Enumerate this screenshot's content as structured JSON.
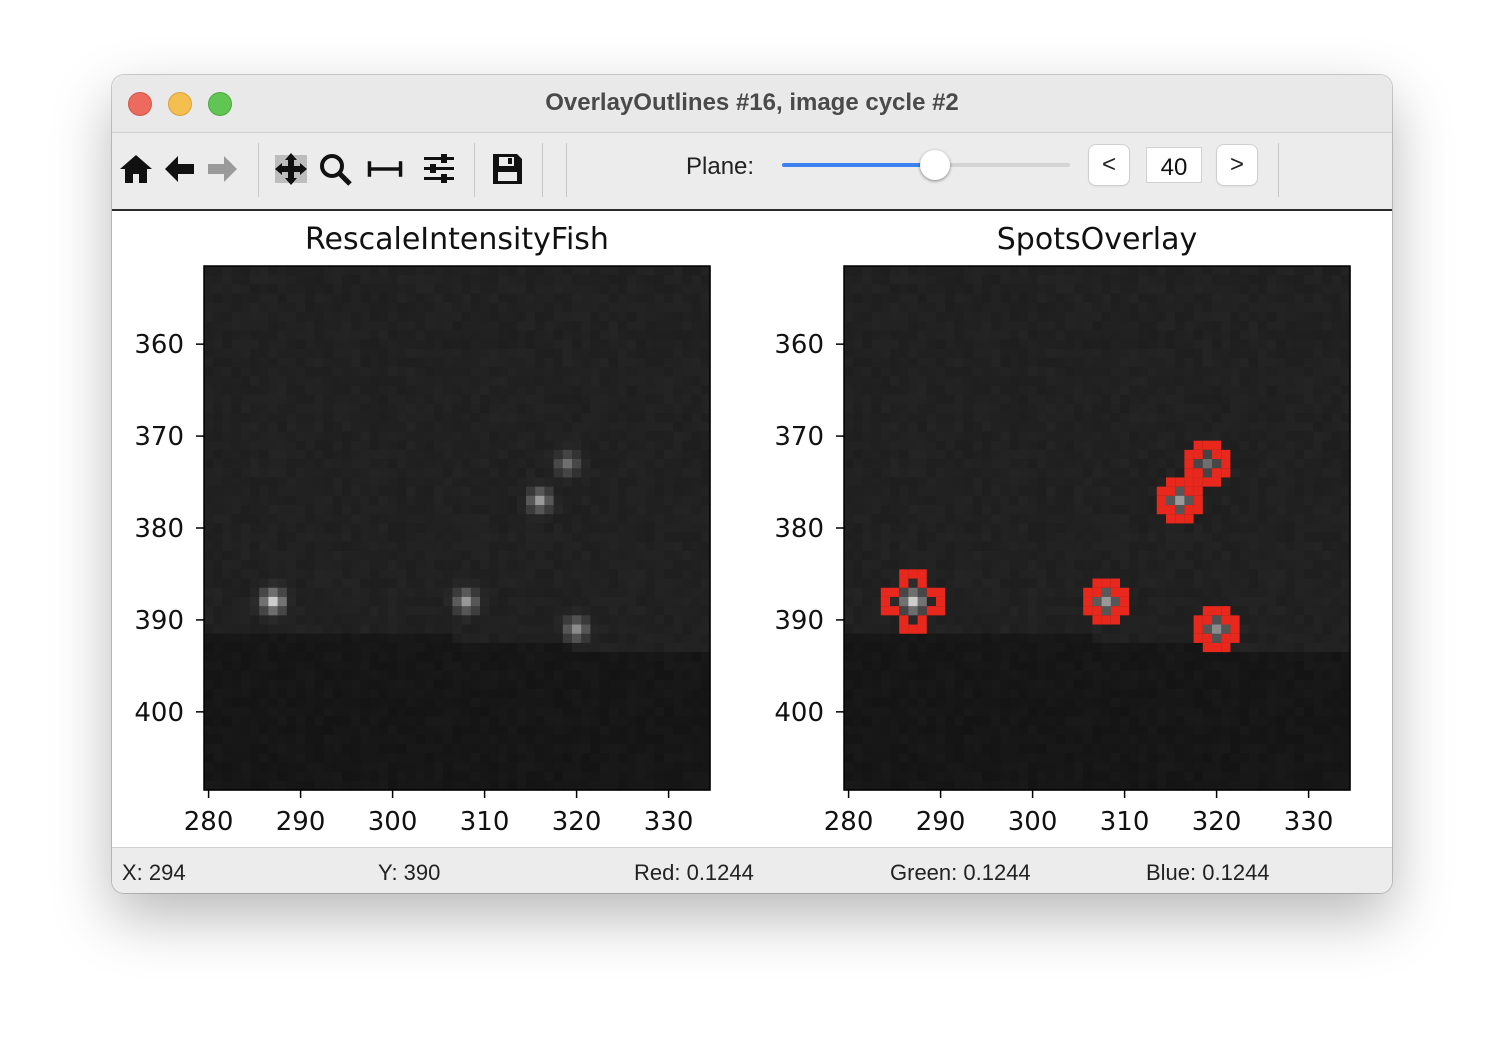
{
  "window": {
    "title": "OverlayOutlines #16, image cycle #2"
  },
  "toolbar": {
    "tools": [
      "home-icon",
      "back-icon",
      "forward-icon",
      "pan-icon",
      "zoom-icon",
      "subplots-icon",
      "configure-icon",
      "save-icon"
    ],
    "plane_label": "Plane:",
    "plane_fraction": 0.53,
    "prev_label": "<",
    "plane_value": "40",
    "next_label": ">"
  },
  "plots": [
    {
      "title": "RescaleIntensityFish",
      "xticks": [
        "280",
        "290",
        "300",
        "310",
        "320",
        "330"
      ],
      "yticks": [
        "360",
        "370",
        "380",
        "390",
        "400"
      ]
    },
    {
      "title": "SpotsOverlay",
      "xticks": [
        "280",
        "290",
        "300",
        "310",
        "320",
        "330"
      ],
      "yticks": [
        "360",
        "370",
        "380",
        "390",
        "400"
      ]
    }
  ],
  "chart_data": {
    "type": "heatmap",
    "xlim": [
      279.5,
      334.5
    ],
    "ylim": [
      351.5,
      408.5
    ],
    "spots": [
      {
        "x": 287,
        "y": 388,
        "brightness": 0.85
      },
      {
        "x": 308,
        "y": 388,
        "brightness": 0.6
      },
      {
        "x": 316,
        "y": 377,
        "brightness": 0.6
      },
      {
        "x": 319,
        "y": 373,
        "brightness": 0.4
      },
      {
        "x": 320,
        "y": 391,
        "brightness": 0.55
      }
    ],
    "outline_color": "#e8281c"
  },
  "status": {
    "x": "X: 294",
    "y": "Y: 390",
    "red": "Red: 0.1244",
    "green": "Green: 0.1244",
    "blue": "Blue: 0.1244"
  }
}
